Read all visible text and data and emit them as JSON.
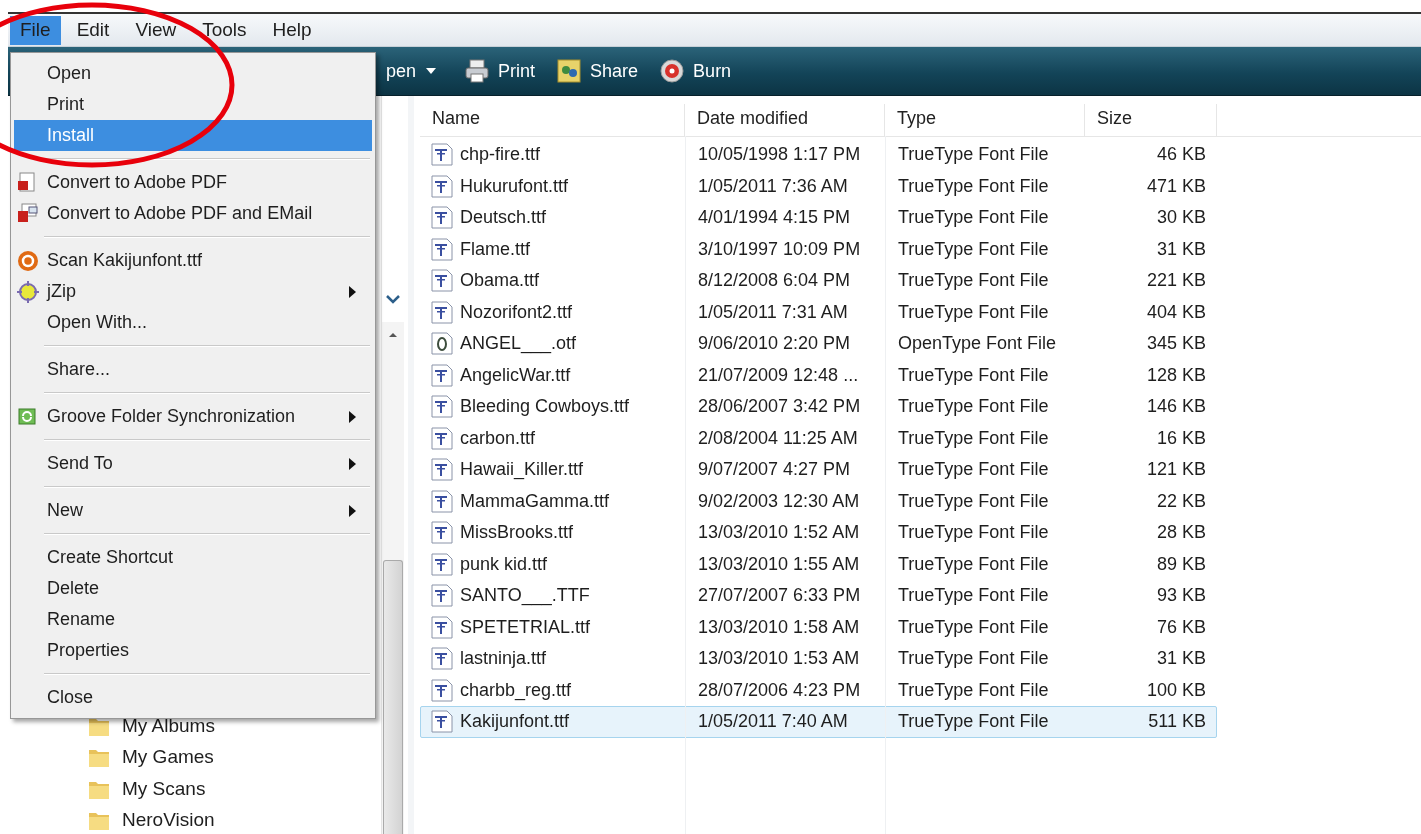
{
  "menu_bar": [
    {
      "label": "File",
      "selected": true
    },
    {
      "label": "Edit",
      "selected": false
    },
    {
      "label": "View",
      "selected": false
    },
    {
      "label": "Tools",
      "selected": false
    },
    {
      "label": "Help",
      "selected": false
    }
  ],
  "toolbar": {
    "items": [
      "pen",
      "Print",
      "Share",
      "Burn"
    ]
  },
  "nav_pane": {
    "folders": [
      "My Albums",
      "My Games",
      "My Scans",
      "NeroVision"
    ]
  },
  "file_list": {
    "columns": [
      "Name",
      "Date modified",
      "Type",
      "Size"
    ],
    "rows": [
      {
        "kind": "truetype",
        "name": "chp-fire.ttf",
        "date_modified": "10/05/1998 1:17 PM",
        "type": "TrueType Font File",
        "size": "46 KB",
        "selected": false
      },
      {
        "kind": "truetype",
        "name": "Hukurufont.ttf",
        "date_modified": "1/05/2011 7:36 AM",
        "type": "TrueType Font File",
        "size": "471 KB",
        "selected": false
      },
      {
        "kind": "truetype",
        "name": "Deutsch.ttf",
        "date_modified": "4/01/1994 4:15 PM",
        "type": "TrueType Font File",
        "size": "30 KB",
        "selected": false
      },
      {
        "kind": "truetype",
        "name": "Flame.ttf",
        "date_modified": "3/10/1997 10:09 PM",
        "type": "TrueType Font File",
        "size": "31 KB",
        "selected": false
      },
      {
        "kind": "truetype",
        "name": "Obama.ttf",
        "date_modified": "8/12/2008 6:04 PM",
        "type": "TrueType Font File",
        "size": "221 KB",
        "selected": false
      },
      {
        "kind": "truetype",
        "name": "Nozorifont2.ttf",
        "date_modified": "1/05/2011 7:31 AM",
        "type": "TrueType Font File",
        "size": "404 KB",
        "selected": false
      },
      {
        "kind": "opentype",
        "name": "ANGEL___.otf",
        "date_modified": "9/06/2010 2:20 PM",
        "type": "OpenType Font File",
        "size": "345 KB",
        "selected": false
      },
      {
        "kind": "truetype",
        "name": "AngelicWar.ttf",
        "date_modified": "21/07/2009 12:48 ...",
        "type": "TrueType Font File",
        "size": "128 KB",
        "selected": false
      },
      {
        "kind": "truetype",
        "name": "Bleeding Cowboys.ttf",
        "date_modified": "28/06/2007 3:42 PM",
        "type": "TrueType Font File",
        "size": "146 KB",
        "selected": false
      },
      {
        "kind": "truetype",
        "name": "carbon.ttf",
        "date_modified": "2/08/2004 11:25 AM",
        "type": "TrueType Font File",
        "size": "16 KB",
        "selected": false
      },
      {
        "kind": "truetype",
        "name": "Hawaii_Killer.ttf",
        "date_modified": "9/07/2007 4:27 PM",
        "type": "TrueType Font File",
        "size": "121 KB",
        "selected": false
      },
      {
        "kind": "truetype",
        "name": "MammaGamma.ttf",
        "date_modified": "9/02/2003 12:30 AM",
        "type": "TrueType Font File",
        "size": "22 KB",
        "selected": false
      },
      {
        "kind": "truetype",
        "name": "MissBrooks.ttf",
        "date_modified": "13/03/2010 1:52 AM",
        "type": "TrueType Font File",
        "size": "28 KB",
        "selected": false
      },
      {
        "kind": "truetype",
        "name": "punk kid.ttf",
        "date_modified": "13/03/2010 1:55 AM",
        "type": "TrueType Font File",
        "size": "89 KB",
        "selected": false
      },
      {
        "kind": "truetype",
        "name": "SANTO___.TTF",
        "date_modified": "27/07/2007 6:33 PM",
        "type": "TrueType Font File",
        "size": "93 KB",
        "selected": false
      },
      {
        "kind": "truetype",
        "name": "SPETETRIAL.ttf",
        "date_modified": "13/03/2010 1:58 AM",
        "type": "TrueType Font File",
        "size": "76 KB",
        "selected": false
      },
      {
        "kind": "truetype",
        "name": "lastninja.ttf",
        "date_modified": "13/03/2010 1:53 AM",
        "type": "TrueType Font File",
        "size": "31 KB",
        "selected": false
      },
      {
        "kind": "truetype",
        "name": "charbb_reg.ttf",
        "date_modified": "28/07/2006 4:23 PM",
        "type": "TrueType Font File",
        "size": "100 KB",
        "selected": false
      },
      {
        "kind": "truetype",
        "name": "Kakijunfont.ttf",
        "date_modified": "1/05/2011 7:40 AM",
        "type": "TrueType Font File",
        "size": "511 KB",
        "selected": true
      }
    ]
  },
  "file_menu": {
    "items": [
      {
        "kind": "item",
        "label": "Open",
        "selected": false,
        "submenu": false
      },
      {
        "kind": "item",
        "label": "Print",
        "selected": false,
        "submenu": false
      },
      {
        "kind": "item",
        "label": "Install",
        "selected": true,
        "submenu": false
      },
      {
        "kind": "separator"
      },
      {
        "kind": "item",
        "label": "Convert to Adobe PDF",
        "selected": false,
        "submenu": false
      },
      {
        "kind": "item",
        "label": "Convert to Adobe PDF and EMail",
        "selected": false,
        "submenu": false
      },
      {
        "kind": "separator"
      },
      {
        "kind": "item",
        "label": "Scan Kakijunfont.ttf",
        "selected": false,
        "submenu": false
      },
      {
        "kind": "item",
        "label": "jZip",
        "selected": false,
        "submenu": true
      },
      {
        "kind": "item",
        "label": "Open With...",
        "selected": false,
        "submenu": false
      },
      {
        "kind": "separator"
      },
      {
        "kind": "item",
        "label": "Share...",
        "selected": false,
        "submenu": false
      },
      {
        "kind": "separator"
      },
      {
        "kind": "item",
        "label": "Groove Folder Synchronization",
        "selected": false,
        "submenu": true
      },
      {
        "kind": "separator"
      },
      {
        "kind": "item",
        "label": "Send To",
        "selected": false,
        "submenu": true
      },
      {
        "kind": "separator"
      },
      {
        "kind": "item",
        "label": "New",
        "selected": false,
        "submenu": true
      },
      {
        "kind": "separator"
      },
      {
        "kind": "item",
        "label": "Create Shortcut",
        "selected": false,
        "submenu": false
      },
      {
        "kind": "item",
        "label": "Delete",
        "selected": false,
        "submenu": false
      },
      {
        "kind": "item",
        "label": "Rename",
        "selected": false,
        "submenu": false
      },
      {
        "kind": "item",
        "label": "Properties",
        "selected": false,
        "submenu": false
      },
      {
        "kind": "separator"
      },
      {
        "kind": "item",
        "label": "Close",
        "selected": false,
        "submenu": false
      }
    ]
  }
}
